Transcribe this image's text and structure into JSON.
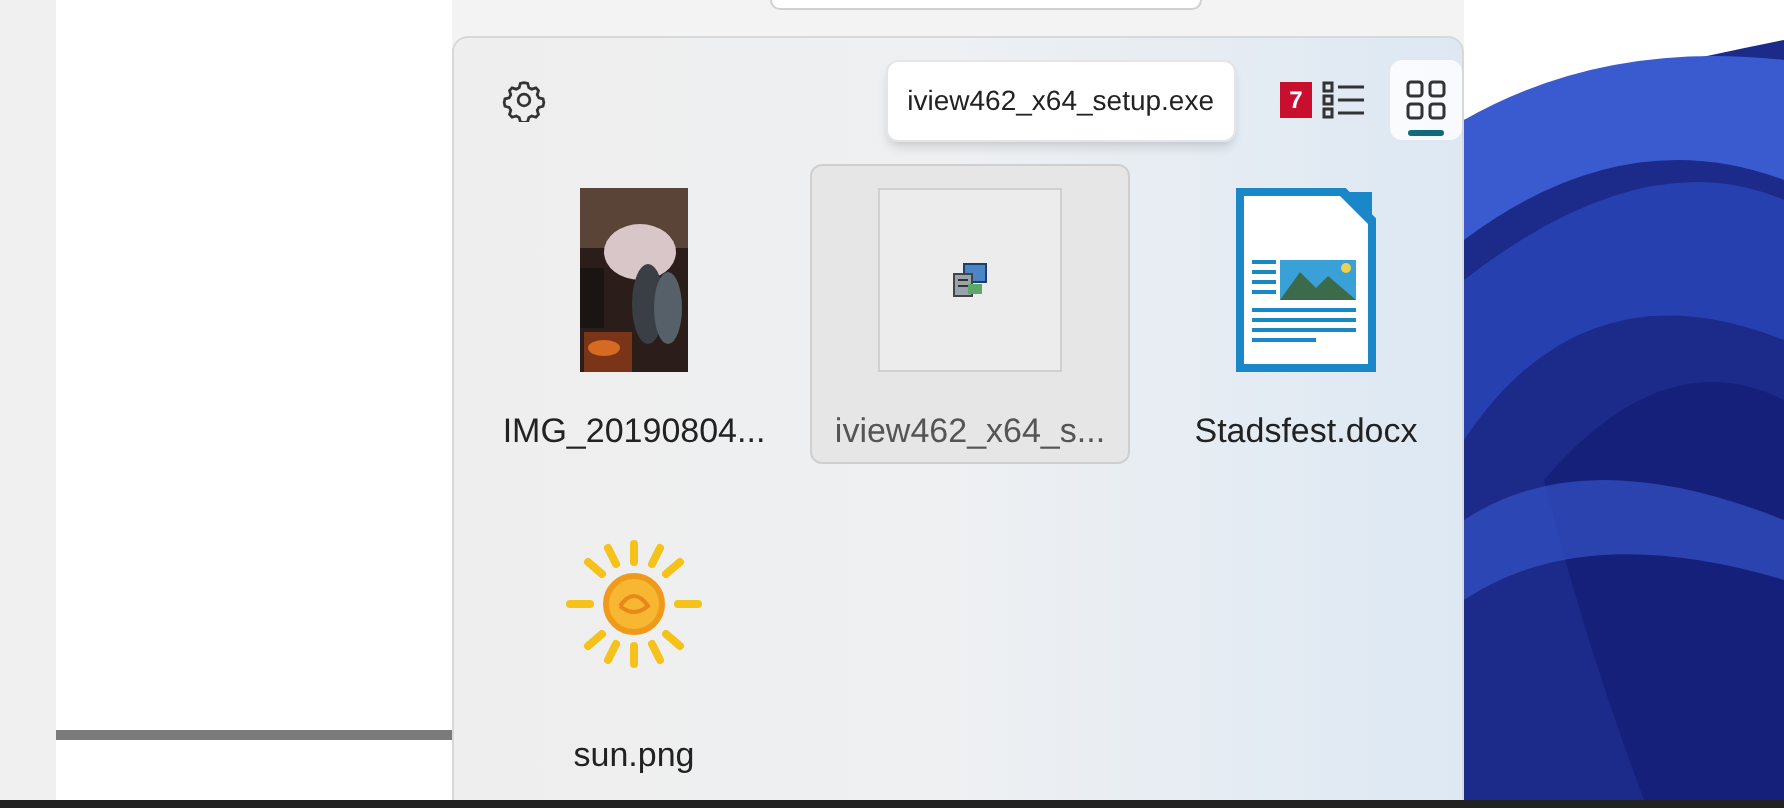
{
  "tooltip": {
    "text": "iview462_x64_setup.exe"
  },
  "badge": {
    "text": "7"
  },
  "views": [
    {
      "kind": "list",
      "selected": false
    },
    {
      "kind": "grid",
      "selected": true
    }
  ],
  "files": [
    {
      "label": "IMG_20190804...",
      "selected": false
    },
    {
      "kind": "exe",
      "label": "iview462_x64_s...",
      "selected": true
    },
    {
      "kind": "document",
      "label": "Stadsfest.docx",
      "selected": false
    },
    {
      "label": "sun.png",
      "selected": false
    }
  ]
}
